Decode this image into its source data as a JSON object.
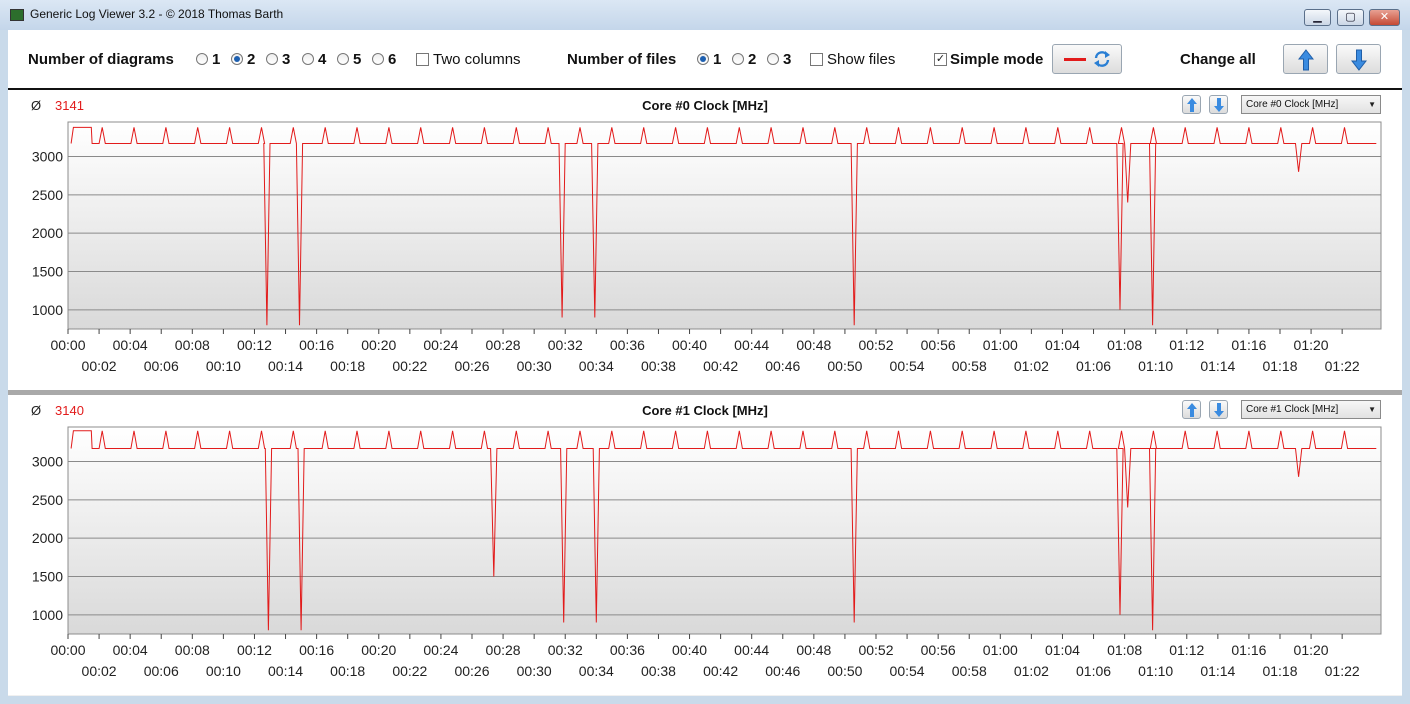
{
  "window": {
    "title": "Generic Log Viewer 3.2 - © 2018 Thomas Barth",
    "minimize_icon": "minimize-icon",
    "maximize_icon": "maximize-icon",
    "close_icon": "close-icon"
  },
  "toolbar": {
    "diagrams_label": "Number of diagrams",
    "diagram_options": [
      "1",
      "2",
      "3",
      "4",
      "5",
      "6"
    ],
    "diagrams_selected": "2",
    "two_columns_label": "Two columns",
    "two_columns_checked": false,
    "files_label": "Number of files",
    "file_options": [
      "1",
      "2",
      "3"
    ],
    "files_selected": "1",
    "show_files_label": "Show files",
    "show_files_checked": false,
    "simple_mode_label": "Simple mode",
    "simple_mode_checked": true,
    "change_all_label": "Change all",
    "line_color": "#e21b1b",
    "accent_color": "#2a7fd4"
  },
  "panels": [
    {
      "title": "Core #0 Clock [MHz]",
      "avg_symbol": "Ø",
      "avg_value": "3141",
      "combo_value": "Core #0 Clock [MHz]"
    },
    {
      "title": "Core #1 Clock [MHz]",
      "avg_symbol": "Ø",
      "avg_value": "3140",
      "combo_value": "Core #1 Clock [MHz]"
    }
  ],
  "chart_data": [
    {
      "type": "line",
      "title": "Core #0 Clock [MHz]",
      "ylim": [
        750,
        3450
      ],
      "y_ticks": [
        1000,
        1500,
        2000,
        2500,
        3000
      ],
      "xlim_minutes": [
        0,
        84.5
      ],
      "x_tick_labels_top": [
        "00:00",
        "00:04",
        "00:08",
        "00:12",
        "00:16",
        "00:20",
        "00:24",
        "00:28",
        "00:32",
        "00:36",
        "00:40",
        "00:44",
        "00:48",
        "00:52",
        "00:56",
        "01:00",
        "01:04",
        "01:08",
        "01:12",
        "01:16",
        "01:20"
      ],
      "x_tick_labels_bottom": [
        "00:02",
        "00:06",
        "00:10",
        "00:14",
        "00:18",
        "00:22",
        "00:26",
        "00:30",
        "00:34",
        "00:38",
        "00:42",
        "00:46",
        "00:50",
        "00:54",
        "00:58",
        "01:02",
        "01:06",
        "01:10",
        "01:14",
        "01:18",
        "01:22"
      ],
      "grid": true,
      "series": [
        {
          "baseline": 3170,
          "start_plateau": 3380,
          "start_plateau_end": 1.5,
          "spike_interval": 2.05,
          "spike_value": 3380,
          "dips": [
            [
              12.8,
              800
            ],
            [
              14.9,
              800
            ],
            [
              31.8,
              900
            ],
            [
              33.9,
              900
            ],
            [
              50.6,
              800
            ],
            [
              67.7,
              1000
            ],
            [
              68.2,
              2400
            ],
            [
              69.8,
              800
            ],
            [
              79.2,
              2800
            ]
          ]
        }
      ]
    },
    {
      "type": "line",
      "title": "Core #1 Clock [MHz]",
      "ylim": [
        750,
        3450
      ],
      "y_ticks": [
        1000,
        1500,
        2000,
        2500,
        3000
      ],
      "xlim_minutes": [
        0,
        84.5
      ],
      "x_tick_labels_top": [
        "00:00",
        "00:04",
        "00:08",
        "00:12",
        "00:16",
        "00:20",
        "00:24",
        "00:28",
        "00:32",
        "00:36",
        "00:40",
        "00:44",
        "00:48",
        "00:52",
        "00:56",
        "01:00",
        "01:04",
        "01:08",
        "01:12",
        "01:16",
        "01:20"
      ],
      "x_tick_labels_bottom": [
        "00:02",
        "00:06",
        "00:10",
        "00:14",
        "00:18",
        "00:22",
        "00:26",
        "00:30",
        "00:34",
        "00:38",
        "00:42",
        "00:46",
        "00:50",
        "00:54",
        "00:58",
        "01:02",
        "01:06",
        "01:10",
        "01:14",
        "01:18",
        "01:22"
      ],
      "grid": true,
      "series": [
        {
          "baseline": 3170,
          "start_plateau": 3400,
          "start_plateau_end": 1.5,
          "spike_interval": 2.05,
          "spike_value": 3400,
          "dips": [
            [
              12.9,
              800
            ],
            [
              15.0,
              800
            ],
            [
              27.4,
              1500
            ],
            [
              31.9,
              900
            ],
            [
              34.0,
              900
            ],
            [
              50.6,
              900
            ],
            [
              67.7,
              1000
            ],
            [
              68.2,
              2400
            ],
            [
              69.8,
              800
            ],
            [
              79.2,
              2800
            ]
          ]
        }
      ]
    }
  ]
}
